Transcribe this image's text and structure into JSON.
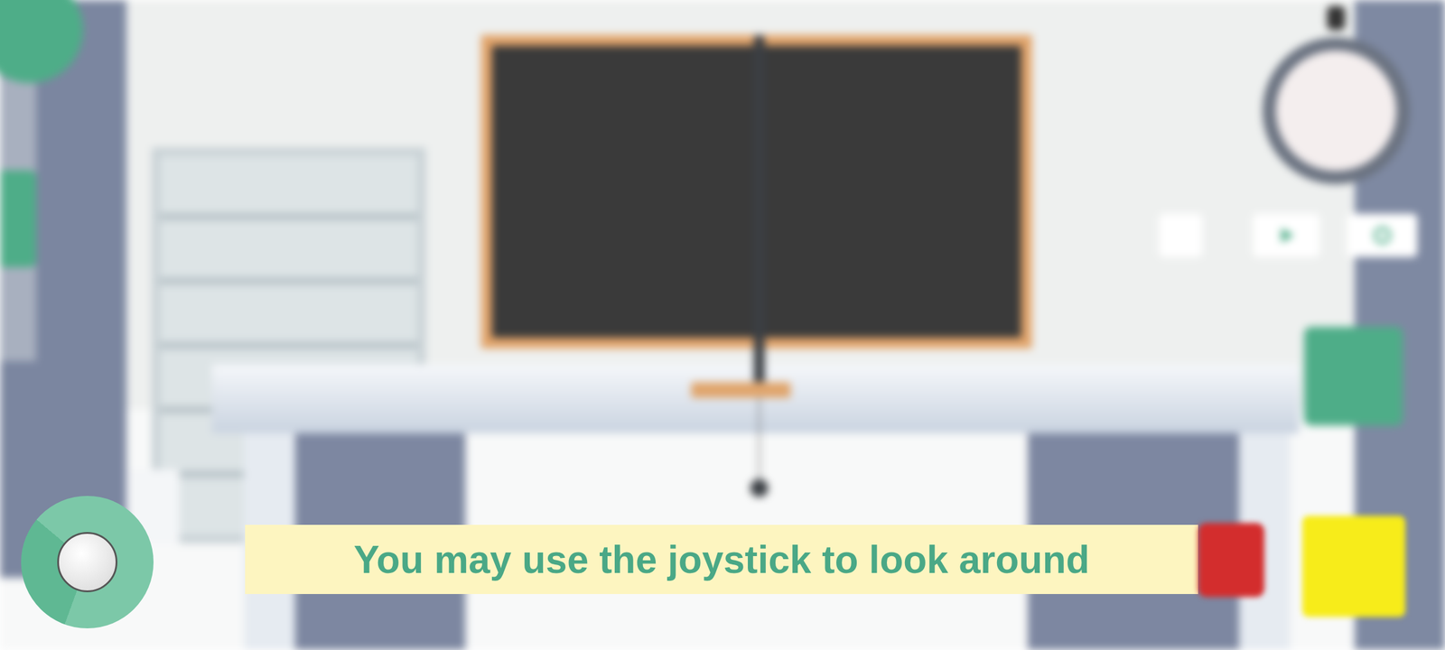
{
  "hint": {
    "text": "You may use the joystick to look around"
  },
  "scene": {
    "blurred": true
  }
}
